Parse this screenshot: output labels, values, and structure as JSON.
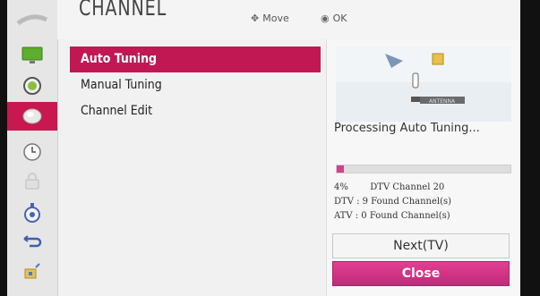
{
  "header": {
    "title": "CHANNEL",
    "move_hint": "Move",
    "ok_hint": "OK"
  },
  "sidebar": {
    "items": [
      {
        "icon": "picture-icon",
        "active": false
      },
      {
        "icon": "audio-icon",
        "active": false
      },
      {
        "icon": "channel-icon",
        "active": true
      },
      {
        "icon": "time-icon",
        "active": false
      },
      {
        "icon": "lock-icon",
        "active": false
      },
      {
        "icon": "option-icon",
        "active": false
      },
      {
        "icon": "input-icon",
        "active": false
      },
      {
        "icon": "usb-icon",
        "active": false
      }
    ]
  },
  "menu": {
    "items": [
      {
        "label": "Auto Tuning",
        "selected": true
      },
      {
        "label": "Manual Tuning",
        "selected": false
      },
      {
        "label": "Channel Edit",
        "selected": false
      }
    ]
  },
  "panel": {
    "antenna_tag": "ANTENNA",
    "processing_text": "Processing Auto Tuning...",
    "progress_percent": 4,
    "progress_label": "4%",
    "current_channel": "DTV Channel 20",
    "dtv_found": "DTV : 9 Found Channel(s)",
    "atv_found": "ATV : 0 Found Channel(s)",
    "next_button": "Next(TV)",
    "close_button": "Close"
  },
  "colors": {
    "accent": "#c11854",
    "close_button": "#d33587",
    "progress": "#d1418c"
  }
}
